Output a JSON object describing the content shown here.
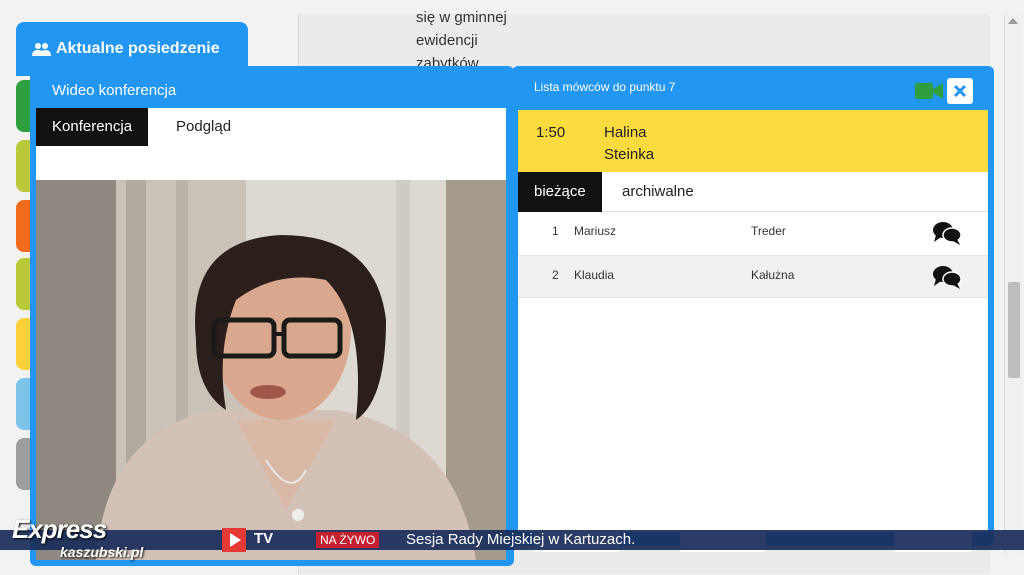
{
  "document": {
    "lines": [
      "się w gminnej",
      "ewidencji",
      "zabytków"
    ]
  },
  "session_tab": {
    "label": "Aktualne posiedzenie",
    "icon": "users-icon"
  },
  "left_tab_colors": [
    "#2e9e3f",
    "#b9c93a",
    "#f26b1d",
    "#b9c93a",
    "#fbd03a",
    "#7cc3ea",
    "#9e9e9e"
  ],
  "video": {
    "title": "Wideo konferencja",
    "tabs": [
      {
        "label": "Konferencja",
        "active": true
      },
      {
        "label": "Podgląd",
        "active": false
      }
    ]
  },
  "speakers": {
    "title": "Lista mówców do punktu 7",
    "camera_icon": "video-camera-icon",
    "close_icon": "close-icon",
    "current": {
      "time": "1:50",
      "first_name": "Halina",
      "last_name": "Steinka"
    },
    "tabs": [
      {
        "label": "bieżące",
        "active": true
      },
      {
        "label": "archiwalne",
        "active": false
      }
    ],
    "list": [
      {
        "num": "1",
        "first": "Mariusz",
        "last": "Treder",
        "icon": "chat-icon"
      },
      {
        "num": "2",
        "first": "Klaudia",
        "last": "Kałużna",
        "icon": "chat-icon"
      }
    ]
  },
  "ticker": {
    "live": "NA ŻYWO",
    "text": "Sesja Rady Miejskiej w Kartuzach."
  },
  "logo": {
    "express": "Express",
    "kaszubski": "kaszubski.pl",
    "tv": "TV"
  },
  "colors": {
    "panel_blue": "#2196f3",
    "highlight_yellow": "#fbdb3e",
    "live_red": "#c5202f"
  }
}
